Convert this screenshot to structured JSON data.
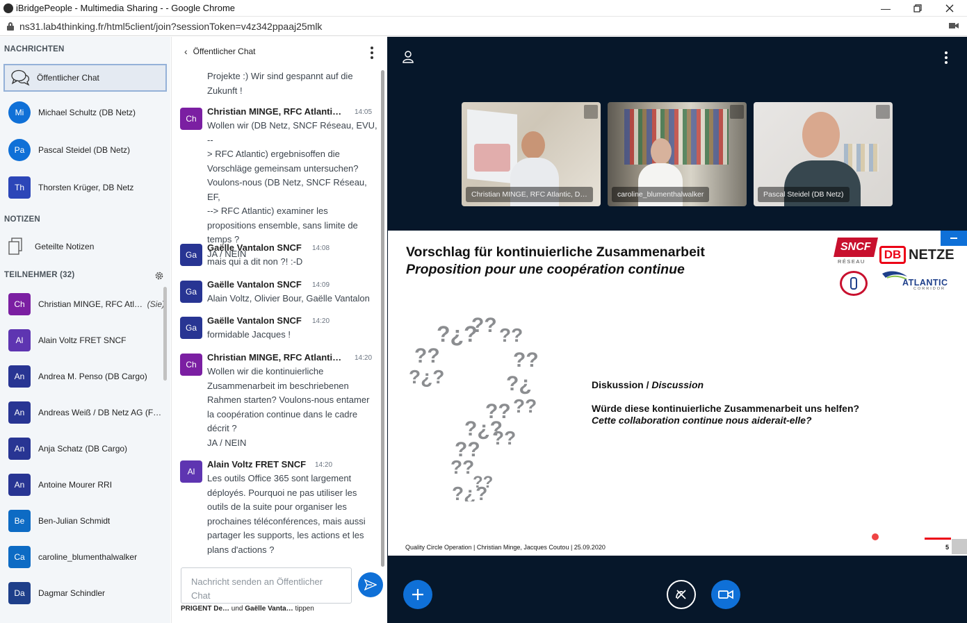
{
  "browser": {
    "title": "iBridgePeople - Multimedia Sharing - - Google Chrome",
    "url": "ns31.lab4thinking.fr/html5client/join?sessionToken=v4z342ppaaj25mlk"
  },
  "sidebar": {
    "messages_title": "NACHRICHTEN",
    "public_chat_label": "Öffentlicher Chat",
    "private_chats": [
      {
        "initials": "Mi",
        "name": "Michael Schultz (DB Netz)",
        "color": "#0f70d7"
      },
      {
        "initials": "Pa",
        "name": "Pascal Steidel (DB Netz)",
        "color": "#0f70d7"
      },
      {
        "initials": "Th",
        "name": "Thorsten Krüger, DB Netz",
        "color": "#2c46b8"
      }
    ],
    "notes_title": "NOTIZEN",
    "shared_notes_label": "Geteilte Notizen",
    "participants_title": "TEILNEHMER (32)",
    "participants": [
      {
        "initials": "Ch",
        "name": "Christian MINGE, RFC Atlan…",
        "you": "(Sie)",
        "color": "#7b1fa2"
      },
      {
        "initials": "Al",
        "name": "Alain Voltz FRET SNCF",
        "you": "",
        "color": "#5e35b1"
      },
      {
        "initials": "An",
        "name": "Andrea M. Penso (DB Cargo)",
        "you": "",
        "color": "#283593"
      },
      {
        "initials": "An",
        "name": "Andreas Weiß / DB Netz AG (Fa…",
        "you": "",
        "color": "#283593"
      },
      {
        "initials": "An",
        "name": "Anja Schatz (DB Cargo)",
        "you": "",
        "color": "#283593"
      },
      {
        "initials": "An",
        "name": "Antoine Mourer RRI",
        "you": "",
        "color": "#283593"
      },
      {
        "initials": "Be",
        "name": "Ben-Julian Schmidt",
        "you": "",
        "color": "#0d6bc4"
      },
      {
        "initials": "Ca",
        "name": "caroline_blumenthalwalker",
        "you": "",
        "color": "#0d6bc4"
      },
      {
        "initials": "Da",
        "name": "Dagmar Schindler",
        "you": "",
        "color": "#1e3f8a"
      }
    ]
  },
  "chat": {
    "title": "Öffentlicher Chat",
    "top_fragment": "Projekte :) Wir sind gespannt auf die\nZukunft !",
    "messages": [
      {
        "initials": "Ch",
        "name": "Christian MINGE, RFC Atlanti…",
        "time": "14:05",
        "color": "#7b1fa2",
        "text": "Wollen wir (DB Netz, SNCF Réseau, EVU, --\n> RFC Atlantic) ergebnisoffen die\nVorschläge gemeinsam untersuchen?\nVoulons-nous (DB Netz, SNCF Réseau, EF,\n--> RFC Atlantic) examiner les\npropositions ensemble, sans limite de\ntemps ?\nJA / NEIN"
      },
      {
        "initials": "Ga",
        "name": "Gaëlle Vantalon SNCF",
        "time": "14:08",
        "color": "#283593",
        "text": "mais qui a dit non ?! :-D"
      },
      {
        "initials": "Ga",
        "name": "Gaëlle Vantalon SNCF",
        "time": "14:09",
        "color": "#283593",
        "text": "Alain Voltz, Olivier Bour, Gaëlle Vantalon"
      },
      {
        "initials": "Ga",
        "name": "Gaëlle Vantalon SNCF",
        "time": "14:20",
        "color": "#283593",
        "text": "formidable Jacques !"
      },
      {
        "initials": "Ch",
        "name": "Christian MINGE, RFC Atlanti…",
        "time": "14:20",
        "color": "#7b1fa2",
        "text": "Wollen wir die kontinuierliche\nZusammenarbeit im beschriebenen\nRahmen starten? Voulons-nous entamer\nla coopération continue dans le cadre\ndécrit ?\nJA / NEIN"
      },
      {
        "initials": "Al",
        "name": "Alain Voltz FRET SNCF",
        "time": "14:20",
        "color": "#5e35b1",
        "text": "Les outils Office 365 sont largement\ndéployés. Pourquoi ne pas utiliser les\noutils de la suite pour organiser les\nprochaines téléconférences, mais aussi\npartager les supports, les actions et les\nplans d'actions ?"
      }
    ],
    "input_placeholder": "Nachricht senden an Öffentlicher Chat",
    "typing_name1": "PRIGENT De…",
    "typing_and": "und",
    "typing_name2": "Gaëlle Vanta…",
    "typing_suffix": "tippen"
  },
  "videos": [
    {
      "name": "Christian MINGE, RFC Atlantic, D…"
    },
    {
      "name": "caroline_blumenthalwalker"
    },
    {
      "name": "Pascal Steidel (DB Netz)"
    }
  ],
  "slide": {
    "title_de": "Vorschlag für kontinuierliche Zusammenarbeit",
    "title_fr": "Proposition pour une coopération continue",
    "discussion_de": "Diskussion /",
    "discussion_fr": "Discussion",
    "question_de": "Würde diese kontinuierliche Zusammenarbeit uns helfen?",
    "question_fr": "Cette collaboration continue nous aiderait-elle?",
    "footer": "Quality Circle Operation | Christian Minge, Jacques Coutou | 25.09.2020",
    "page": "5",
    "logo_sncf": "SNCF",
    "logo_reseau": "RÉSEAU",
    "logo_db": "DB",
    "logo_netze": "NETZE",
    "logo_atlantic": "ATLANTIC",
    "logo_corridor": "CORRIDOR"
  },
  "colors": {
    "accent": "#0f70d7",
    "main_bg": "#06172a"
  }
}
